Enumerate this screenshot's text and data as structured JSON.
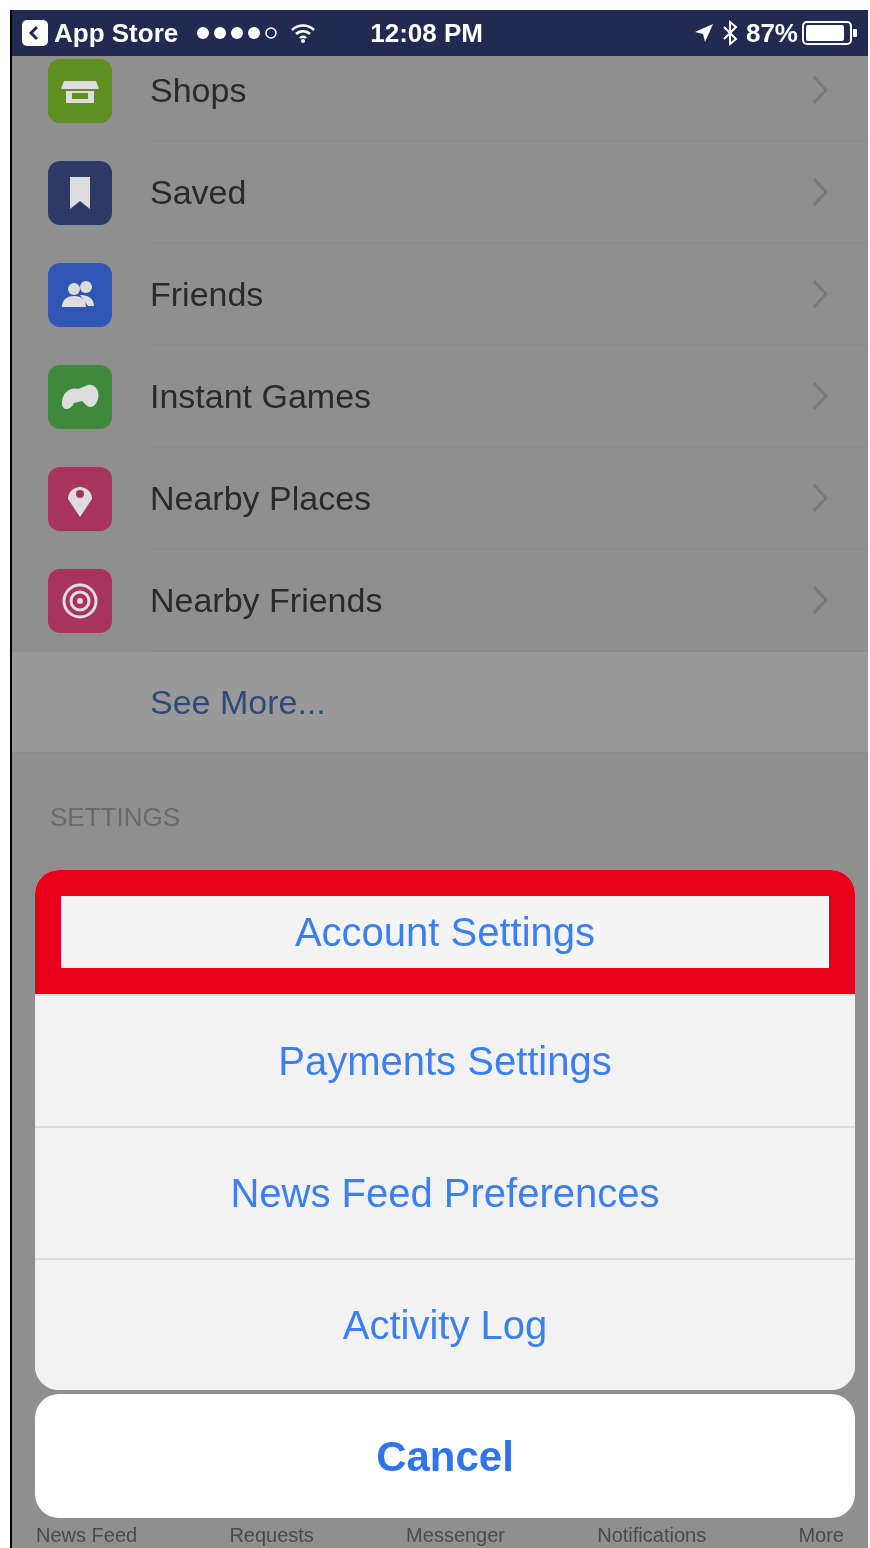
{
  "status_bar": {
    "back_label": "App Store",
    "time": "12:08 PM",
    "battery": "87%"
  },
  "menu_items": [
    {
      "label": "Shops",
      "kind": "shop",
      "color": "#5f8f1f"
    },
    {
      "label": "Saved",
      "kind": "saved",
      "color": "#2e3a66"
    },
    {
      "label": "Friends",
      "kind": "friends",
      "color": "#2f55b5"
    },
    {
      "label": "Instant Games",
      "kind": "games",
      "color": "#3f8a3a"
    },
    {
      "label": "Nearby Places",
      "kind": "place",
      "color": "#a8335f"
    },
    {
      "label": "Nearby Friends",
      "kind": "radar",
      "color": "#a8335f"
    }
  ],
  "see_more": "See More...",
  "section_header": "SETTINGS",
  "action_sheet": {
    "items": [
      {
        "label": "Account Settings",
        "highlighted": true
      },
      {
        "label": "Payments Settings",
        "highlighted": false
      },
      {
        "label": "News Feed Preferences",
        "highlighted": false
      },
      {
        "label": "Activity Log",
        "highlighted": false
      }
    ],
    "cancel": "Cancel"
  },
  "tab_bar": [
    "News Feed",
    "Requests",
    "Messenger",
    "Notifications",
    "More"
  ]
}
